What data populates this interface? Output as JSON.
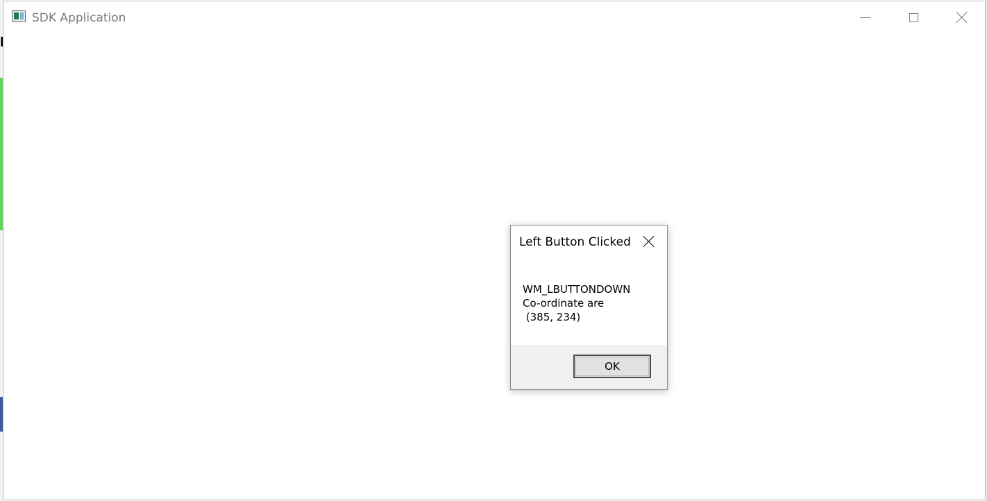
{
  "window": {
    "title": "SDK Application",
    "icon": "app-window-icon",
    "controls": {
      "minimize_icon": "minimize-icon",
      "maximize_icon": "maximize-icon",
      "close_icon": "close-icon"
    }
  },
  "background": {
    "left_fragment_text": "K"
  },
  "dialog": {
    "title": "Left Button Clicked",
    "message_lines": [
      "WM_LBUTTONDOWN",
      "Co-ordinate are",
      " (385, 234)"
    ],
    "ok_label": "OK"
  }
}
